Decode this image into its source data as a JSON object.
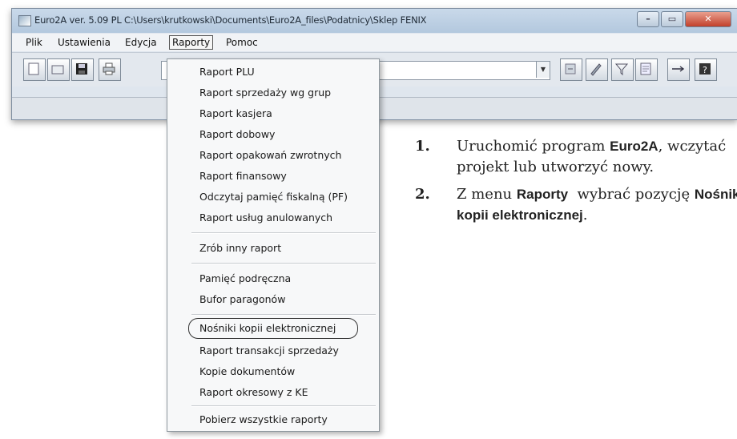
{
  "window": {
    "title": "Euro2A ver. 5.09 PL   C:\\Users\\krutkowski\\Documents\\Euro2A_files\\Podatnicy\\Sklep FENIX"
  },
  "menubar": {
    "items": [
      "Plik",
      "Ustawienia",
      "Edycja",
      "Raporty",
      "Pomoc"
    ],
    "active": "Raporty"
  },
  "toolbar": {
    "combo_value": ""
  },
  "dropdown": {
    "groups": [
      [
        "Raport PLU",
        "Raport sprzedaży wg grup",
        "Raport kasjera",
        "Raport dobowy",
        "Raport opakowań zwrotnych",
        "Raport finansowy",
        "Odczytaj pamięć fiskalną (PF)",
        "Raport usług anulowanych"
      ],
      [
        "Zrób inny raport"
      ],
      [
        "Pamięć podręczna",
        "Bufor paragonów"
      ],
      [
        "Nośniki kopii elektronicznej",
        "Raport transakcji sprzedaży",
        "Kopie dokumentów",
        "Raport okresowy z KE"
      ],
      [
        "Pobierz wszystkie raporty"
      ]
    ],
    "highlighted": "Nośniki kopii elektronicznej"
  },
  "instructions": {
    "step1": {
      "num": "1.",
      "pre": "Uruchomić program ",
      "bold": "Euro2A",
      "post": ", wczytać projekt lub utworzyć nowy."
    },
    "step2": {
      "num": "2.",
      "pre": "Z menu ",
      "bold": "Raporty",
      "mid": "  wybrać pozycję ",
      "bold2": "Nośniki kopii elektronicznej",
      "post": "."
    }
  },
  "icons": [
    "app-icon",
    "new-icon",
    "open-icon",
    "save-icon",
    "print-icon",
    "dropdown-arrow-icon",
    "import-icon",
    "edit-icon",
    "filter-icon",
    "notes-icon",
    "usb-icon",
    "help-icon"
  ]
}
